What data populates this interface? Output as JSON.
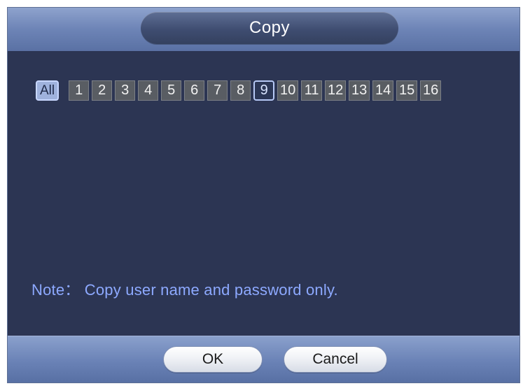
{
  "dialog": {
    "title": "Copy"
  },
  "channels": {
    "all_label": "All",
    "items": [
      "1",
      "2",
      "3",
      "4",
      "5",
      "6",
      "7",
      "8",
      "9",
      "10",
      "11",
      "12",
      "13",
      "14",
      "15",
      "16"
    ],
    "selected": "9"
  },
  "note": {
    "text": "Note： Copy user name and password only."
  },
  "buttons": {
    "ok_label": "OK",
    "cancel_label": "Cancel"
  },
  "colors": {
    "panel_background": "#2c3553",
    "title_bar": "#6d84b6",
    "note_text": "#8da9ff",
    "channel_box": "#595d63",
    "selected_outline": "#b6c8f5"
  }
}
